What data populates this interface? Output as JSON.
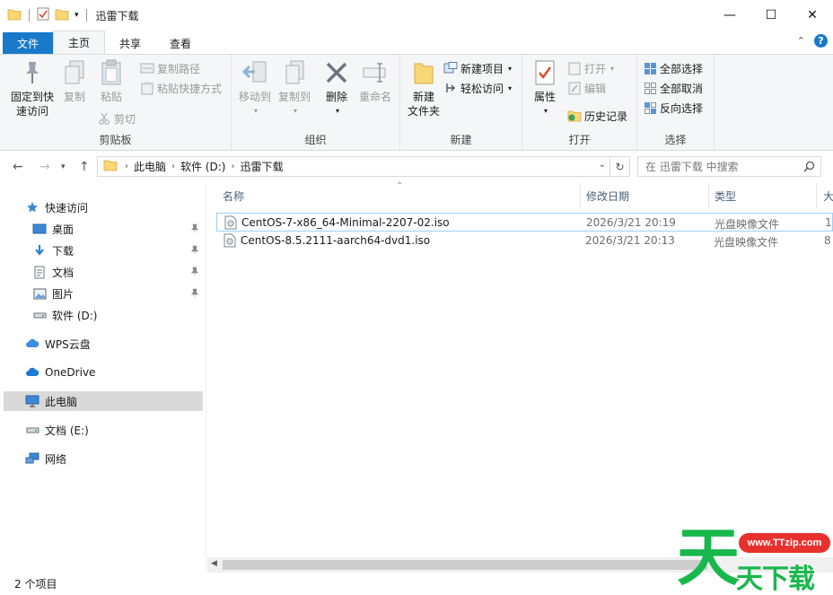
{
  "window": {
    "title": "迅雷下载",
    "controls": {
      "minimize": "—",
      "maximize": "☐",
      "close": "✕"
    }
  },
  "tabs": {
    "file": "文件",
    "items": [
      {
        "label": "主页",
        "active": true
      },
      {
        "label": "共享",
        "active": false
      },
      {
        "label": "查看",
        "active": false
      }
    ]
  },
  "ribbon": {
    "clipboard": {
      "label": "剪贴板",
      "pin_quick_access": [
        "固定到快",
        "速访问"
      ],
      "copy": "复制",
      "paste": "粘贴",
      "copy_path": "复制路径",
      "paste_shortcut": "粘贴快捷方式",
      "cut": "剪切"
    },
    "organize": {
      "label": "组织",
      "move_to": "移动到",
      "copy_to": "复制到",
      "delete": "删除",
      "rename": "重命名"
    },
    "new": {
      "label": "新建",
      "new_item": "新建项目",
      "easy_access": "轻松访问",
      "new_folder": [
        "新建",
        "文件夹"
      ]
    },
    "open": {
      "label": "打开",
      "properties": "属性",
      "open": "打开",
      "edit": "编辑",
      "history": "历史记录"
    },
    "select": {
      "label": "选择",
      "select_all": "全部选择",
      "select_none": "全部取消",
      "invert": "反向选择"
    }
  },
  "address": {
    "crumbs": [
      "此电脑",
      "软件 (D:)",
      "迅雷下载"
    ],
    "search_placeholder": "在 迅雷下载 中搜索"
  },
  "nav": {
    "quick_access": "快速访问",
    "items": [
      {
        "label": "桌面",
        "pinned": true
      },
      {
        "label": "下载",
        "pinned": true
      },
      {
        "label": "文档",
        "pinned": true
      },
      {
        "label": "图片",
        "pinned": true
      },
      {
        "label": "软件 (D:)",
        "pinned": false
      }
    ],
    "wps": "WPS云盘",
    "onedrive": "OneDrive",
    "this_pc": "此电脑",
    "drive_e": "文档 (E:)",
    "network": "网络"
  },
  "columns": {
    "name": "名称",
    "modified": "修改日期",
    "type": "类型",
    "size": "大"
  },
  "files": [
    {
      "name": "CentOS-7-x86_64-Minimal-2207-02.iso",
      "modified": "2026/3/21 20:19",
      "type": "光盘映像文件",
      "size": "1"
    },
    {
      "name": "CentOS-8.5.2111-aarch64-dvd1.iso",
      "modified": "2026/3/21 20:13",
      "type": "光盘映像文件",
      "size": "8"
    }
  ],
  "status": {
    "count": "2 个项目"
  },
  "watermark": {
    "url": "www.TTzip.com",
    "big": "天",
    "text": "天下载"
  },
  "colors": {
    "accent": "#1979ca",
    "watermark_green": "#19b84c",
    "watermark_red": "#e8312d"
  }
}
